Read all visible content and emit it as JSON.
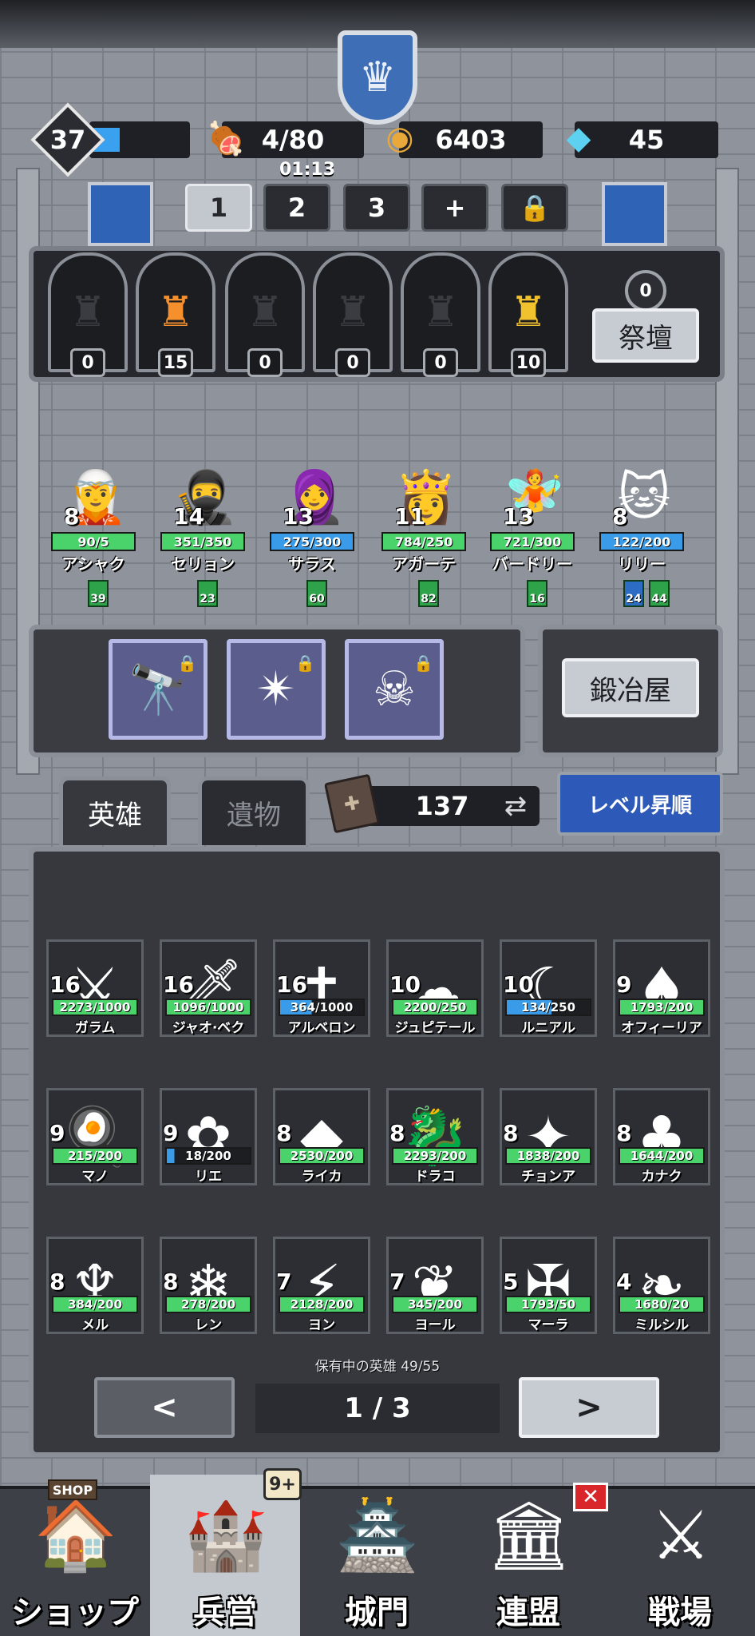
{
  "player": {
    "level": "37",
    "xp_fraction": 0.3,
    "meat": "4/80",
    "meat_timer": "01:13",
    "gold": "6403",
    "gems": "45"
  },
  "party_tabs": [
    "1",
    "2",
    "3",
    "+"
  ],
  "altar": {
    "statue_counts": [
      "0",
      "15",
      "0",
      "0",
      "0",
      "10"
    ],
    "badge": "0",
    "button": "祭壇"
  },
  "party": [
    {
      "name": "アシャク",
      "level": "8",
      "hp": "90/5",
      "tags": [
        "39"
      ],
      "bar": "green"
    },
    {
      "name": "セリョン",
      "level": "14",
      "hp": "351/350",
      "tags": [
        "23"
      ],
      "bar": "green"
    },
    {
      "name": "サラス",
      "level": "13",
      "hp": "275/300",
      "tags": [
        "60"
      ],
      "bar": "blue"
    },
    {
      "name": "アガーテ",
      "level": "11",
      "hp": "784/250",
      "tags": [
        "82"
      ],
      "bar": "green"
    },
    {
      "name": "バードリー",
      "level": "13",
      "hp": "721/300",
      "tags": [
        "16"
      ],
      "bar": "green"
    },
    {
      "name": "リリー",
      "level": "8",
      "hp": "122/200",
      "tags": [
        "24",
        "44"
      ],
      "bar": "blue"
    }
  ],
  "smithy": {
    "button": "鍛冶屋"
  },
  "tabs": {
    "heroes": "英雄",
    "relics": "遺物"
  },
  "books": "137",
  "sort_button": "レベル昇順",
  "heroes": [
    {
      "name": "ガラム",
      "level": "16",
      "hp": "2273/1000",
      "bar": "green",
      "icon": "⚔"
    },
    {
      "name": "ジャオ·ベク",
      "level": "16",
      "hp": "1096/1000",
      "bar": "green",
      "icon": "🗡"
    },
    {
      "name": "アルベロン",
      "level": "16",
      "hp": "364/1000",
      "bar": "blue",
      "icon": "✝"
    },
    {
      "name": "ジュピテール",
      "level": "10",
      "hp": "2200/250",
      "bar": "green",
      "icon": "☁"
    },
    {
      "name": "ルニアル",
      "level": "10",
      "hp": "134/250",
      "bar": "blue3",
      "icon": "☾"
    },
    {
      "name": "オフィーリア",
      "level": "9",
      "hp": "1793/200",
      "bar": "green",
      "icon": "♠"
    },
    {
      "name": "マノ",
      "level": "9",
      "hp": "215/200",
      "bar": "green",
      "icon": "🍳"
    },
    {
      "name": "リエ",
      "level": "9",
      "hp": "18/200",
      "bar": "blue2",
      "icon": "✿"
    },
    {
      "name": "ライカ",
      "level": "8",
      "hp": "2530/200",
      "bar": "green",
      "icon": "◆"
    },
    {
      "name": "ドラコ",
      "level": "8",
      "hp": "2293/200",
      "bar": "green",
      "icon": "🐉"
    },
    {
      "name": "チョンア",
      "level": "8",
      "hp": "1838/200",
      "bar": "green",
      "icon": "✦"
    },
    {
      "name": "カナク",
      "level": "8",
      "hp": "1644/200",
      "bar": "green",
      "icon": "♣"
    },
    {
      "name": "メル",
      "level": "8",
      "hp": "384/200",
      "bar": "green",
      "icon": "♆"
    },
    {
      "name": "レン",
      "level": "8",
      "hp": "278/200",
      "bar": "green",
      "icon": "❄"
    },
    {
      "name": "ヨン",
      "level": "7",
      "hp": "2128/200",
      "bar": "green",
      "icon": "⚡"
    },
    {
      "name": "ヨール",
      "level": "7",
      "hp": "345/200",
      "bar": "green",
      "icon": "❦"
    },
    {
      "name": "マーラ",
      "level": "5",
      "hp": "1793/50",
      "bar": "green",
      "icon": "✠"
    },
    {
      "name": "ミルシル",
      "level": "4",
      "hp": "1680/20",
      "bar": "green",
      "icon": "❧"
    }
  ],
  "owned_heroes": "保有中の英雄 49/55",
  "pager": {
    "prev": "<",
    "page": "1 / 3",
    "next": ">"
  },
  "nav": {
    "shop_sign": "SHOP",
    "items": [
      "ショップ",
      "兵営",
      "城門",
      "連盟",
      "戦場"
    ],
    "barracks_badge": "9+",
    "alliance_badge": "✕"
  },
  "colors": {
    "hp_green": "#4ad36b",
    "hp_blue": "#3a9be8",
    "sort_blue": "#2d59b8",
    "statue_fire": "#f5902c"
  }
}
